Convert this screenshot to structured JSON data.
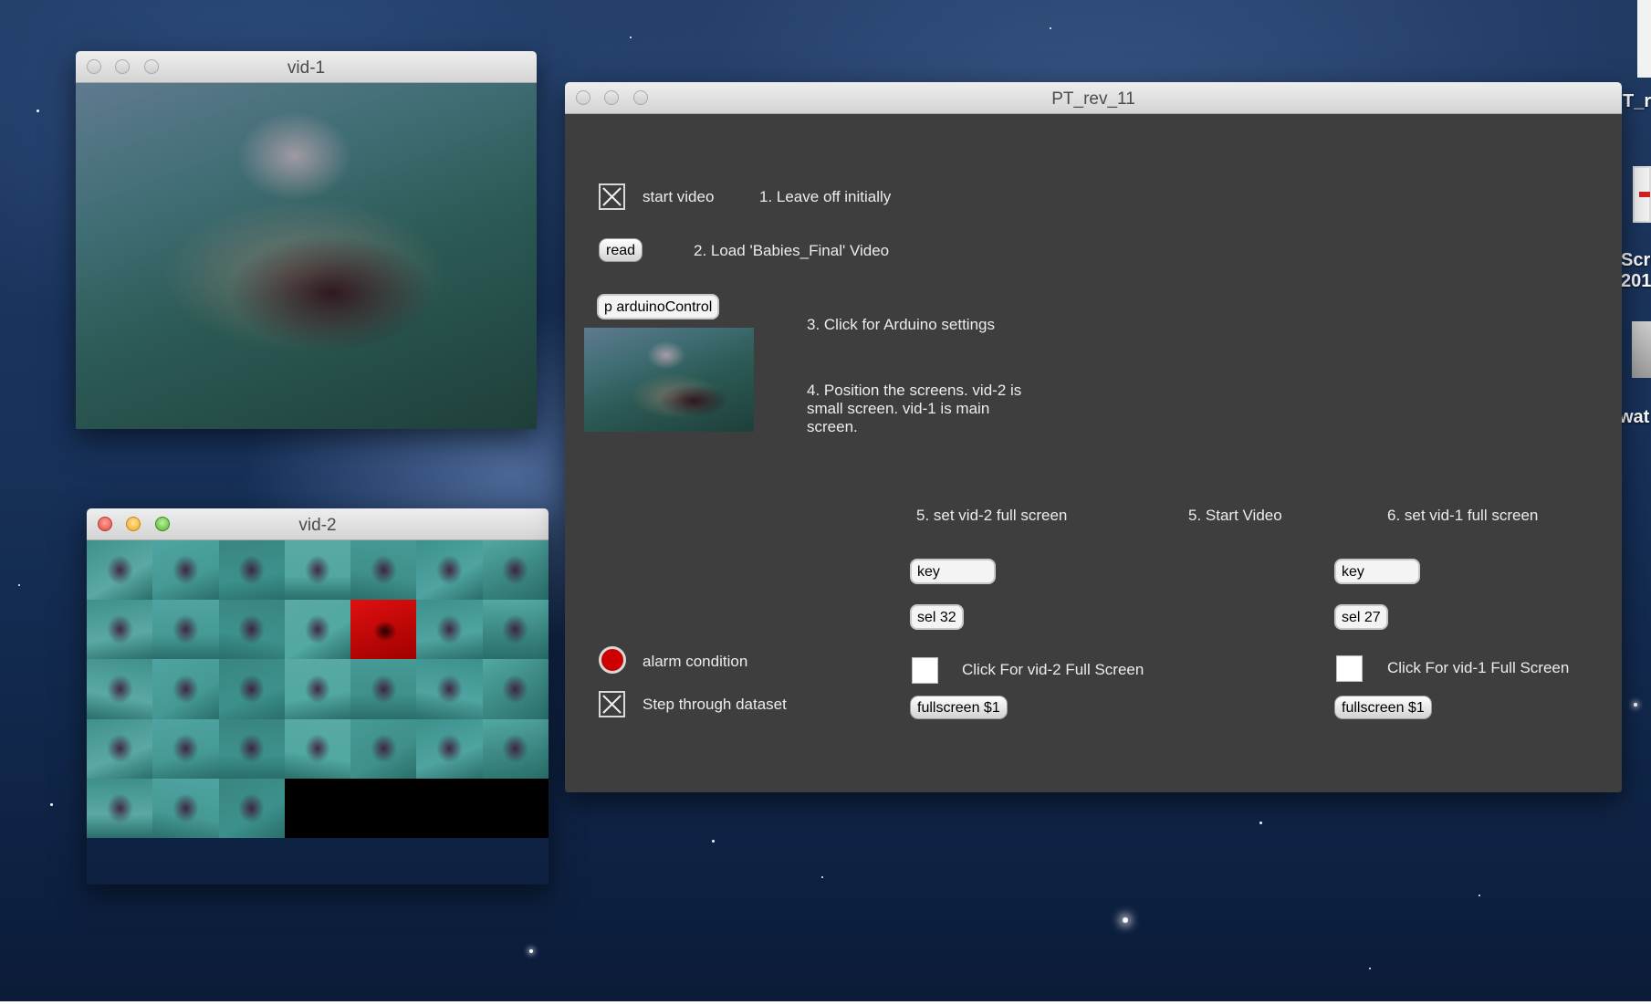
{
  "desktop": {
    "edge_items": [
      "T_r",
      "Scre",
      "201",
      "wat"
    ]
  },
  "vid1": {
    "title": "vid-1"
  },
  "vid2": {
    "title": "vid-2",
    "frames": [
      "water",
      "water",
      "water",
      "water",
      "water",
      "water",
      "water",
      "water",
      "water",
      "water",
      "water",
      "alarm",
      "water",
      "water",
      "water",
      "water",
      "water",
      "water",
      "water",
      "water",
      "water",
      "water",
      "water",
      "water",
      "water",
      "water",
      "water",
      "water",
      "water",
      "water",
      "water",
      "empty",
      "empty",
      "empty",
      "empty"
    ]
  },
  "patcher": {
    "title": "PT_rev_11",
    "start_video_label": "start video",
    "step1": "1. Leave off initially",
    "read_button": "read",
    "step2": "2. Load 'Babies_Final' Video",
    "arduino_object": "p arduinoControl",
    "step3": "3. Click for Arduino settings",
    "step4": "4. Position the screens. vid-2 is small screen. vid-1 is main screen.",
    "step5a": "5. set vid-2 full screen",
    "step5b": "5. Start Video",
    "step6": "6. set vid-1 full screen",
    "key_left": "key",
    "sel_left": "sel 32",
    "click_left": "Click For vid-2 Full Screen",
    "fullscreen_left": "fullscreen $1",
    "key_right": "key",
    "sel_right": "sel 27",
    "click_right": "Click For vid-1 Full Screen",
    "fullscreen_right": "fullscreen $1",
    "alarm_label": "alarm condition",
    "step_label": "Step through dataset",
    "start_video_checked": true,
    "step_checked": true,
    "alarm_color": "#cc0000"
  }
}
